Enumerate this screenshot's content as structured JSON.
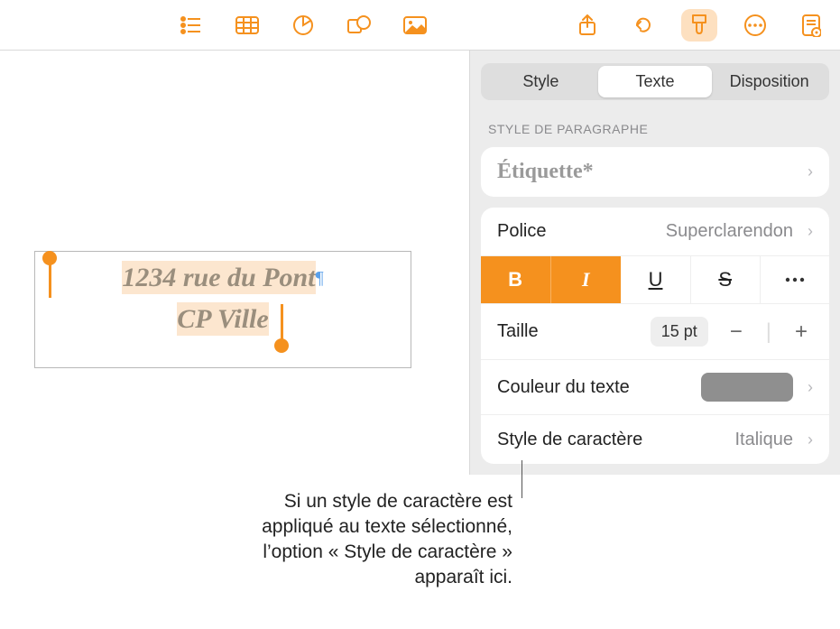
{
  "toolbar": {
    "icons": {
      "list": "list-icon",
      "table": "table-icon",
      "chart": "chart-icon",
      "shape": "shape-icon",
      "media": "media-icon",
      "share": "share-icon",
      "undo": "undo-icon",
      "format": "format-brush-icon",
      "more": "more-icon",
      "document": "document-settings-icon"
    }
  },
  "canvas": {
    "text_line1": "1234 rue du Pont",
    "text_line2": "CP Ville",
    "pilcrow": "¶"
  },
  "inspector": {
    "tabs": {
      "style": "Style",
      "texte": "Texte",
      "disposition": "Disposition"
    },
    "section_paragraph": "STYLE DE PARAGRAPHE",
    "paragraph_style": "Étiquette*",
    "font_label": "Police",
    "font_value": "Superclarendon",
    "buttons": {
      "bold": "B",
      "italic": "I",
      "underline": "U",
      "strike": "S",
      "more": "more-icon"
    },
    "size_label": "Taille",
    "size_value": "15 pt",
    "color_label": "Couleur du texte",
    "color_value": "#8f8f8f",
    "charstyle_label": "Style de caractère",
    "charstyle_value": "Italique"
  },
  "callout": {
    "text": "Si un style de caractère est appliqué au texte sélectionné, l’option « Style de caractère » apparaît ici."
  }
}
